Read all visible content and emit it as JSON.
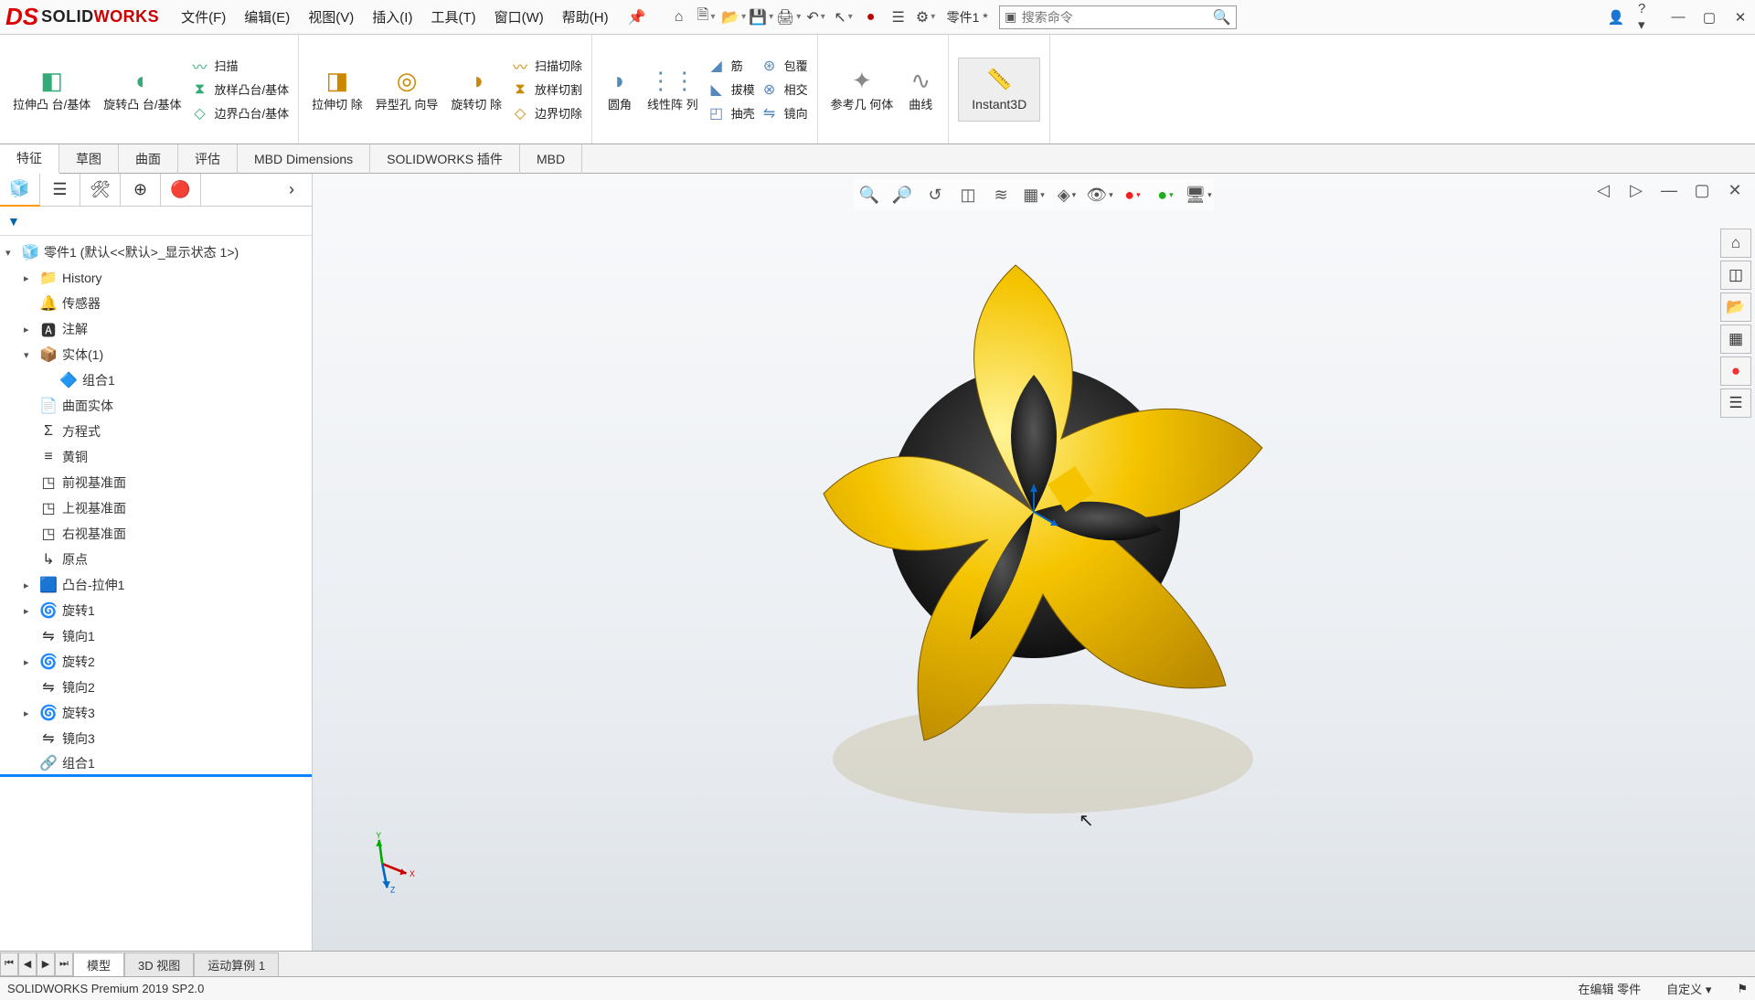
{
  "brand": {
    "solid": "SOLID",
    "works": "WORKS"
  },
  "menus": [
    "文件(F)",
    "编辑(E)",
    "视图(V)",
    "插入(I)",
    "工具(T)",
    "窗口(W)",
    "帮助(H)"
  ],
  "doc_label": "零件1 *",
  "search_placeholder": "搜索命令",
  "ribbon": {
    "extrude_boss": "拉伸凸\n台/基体",
    "revolve_boss": "旋转凸\n台/基体",
    "sweep": "扫描",
    "loft_boss": "放样凸台/基体",
    "boundary_boss": "边界凸台/基体",
    "extrude_cut": "拉伸切\n除",
    "hole_wizard": "异型孔\n向导",
    "revolve_cut": "旋转切\n除",
    "sweep_cut": "扫描切除",
    "loft_cut": "放样切割",
    "boundary_cut": "边界切除",
    "fillet": "圆角",
    "linear_pattern": "线性阵\n列",
    "rib": "筋",
    "draft": "拔模",
    "shell": "抽壳",
    "wrap": "包覆",
    "intersect": "相交",
    "mirror": "镜向",
    "reference": "参考几\n何体",
    "curves": "曲线",
    "instant3d": "Instant3D"
  },
  "tabs": [
    "特征",
    "草图",
    "曲面",
    "评估",
    "MBD Dimensions",
    "SOLIDWORKS 插件",
    "MBD"
  ],
  "tree": {
    "root": "零件1  (默认<<默认>_显示状态 1>)",
    "items": [
      {
        "icon": "📁",
        "label": "History",
        "caret": "▸",
        "indent": 1
      },
      {
        "icon": "🔔",
        "label": "传感器",
        "indent": 1
      },
      {
        "icon": "🅰",
        "label": "注解",
        "caret": "▸",
        "indent": 1
      },
      {
        "icon": "📦",
        "label": "实体(1)",
        "caret": "▾",
        "indent": 1
      },
      {
        "icon": "🔷",
        "label": "组合1",
        "indent": 2
      },
      {
        "icon": "📄",
        "label": "曲面实体",
        "indent": 1
      },
      {
        "icon": "Σ",
        "label": "方程式",
        "indent": 1
      },
      {
        "icon": "≡",
        "label": "黄铜",
        "indent": 1
      },
      {
        "icon": "◳",
        "label": "前视基准面",
        "indent": 1
      },
      {
        "icon": "◳",
        "label": "上视基准面",
        "indent": 1
      },
      {
        "icon": "◳",
        "label": "右视基准面",
        "indent": 1
      },
      {
        "icon": "↳",
        "label": "原点",
        "indent": 1
      },
      {
        "icon": "🟦",
        "label": "凸台-拉伸1",
        "caret": "▸",
        "indent": 1
      },
      {
        "icon": "🌀",
        "label": "旋转1",
        "caret": "▸",
        "indent": 1
      },
      {
        "icon": "⇋",
        "label": "镜向1",
        "indent": 1
      },
      {
        "icon": "🌀",
        "label": "旋转2",
        "caret": "▸",
        "indent": 1
      },
      {
        "icon": "⇋",
        "label": "镜向2",
        "indent": 1
      },
      {
        "icon": "🌀",
        "label": "旋转3",
        "caret": "▸",
        "indent": 1
      },
      {
        "icon": "⇋",
        "label": "镜向3",
        "indent": 1
      },
      {
        "icon": "🔗",
        "label": "组合1",
        "indent": 1,
        "selected": true
      }
    ]
  },
  "bottom_tabs": [
    "模型",
    "3D 视图",
    "运动算例 1"
  ],
  "status": {
    "left": "SOLIDWORKS Premium 2019 SP2.0",
    "mode": "在编辑 零件",
    "units": "自定义",
    "arrow": "▾"
  },
  "colors": {
    "accent_yellow": "#f5c400",
    "accent_dark": "#1a1a1a"
  }
}
